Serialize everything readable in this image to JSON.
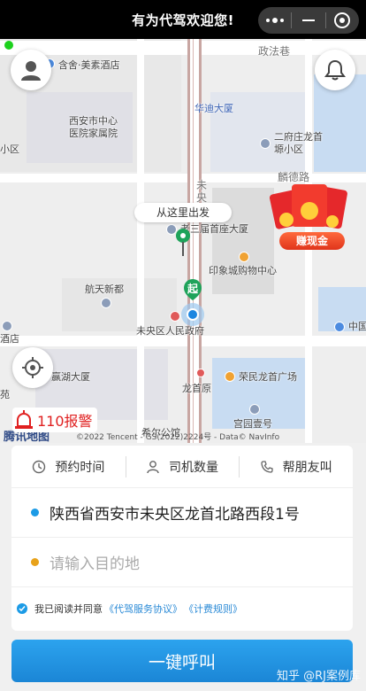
{
  "app": {
    "title": "有为代驾欢迎您!"
  },
  "capsule": {
    "more_icon": "more-dots-icon",
    "minimize_icon": "minus-icon",
    "close_icon": "target-circle-icon"
  },
  "map": {
    "labels": {
      "hotel1": "含舍·美素酒店",
      "lane": "政法巷",
      "huadi": "华迪大厦",
      "hospital_a": "西安市中心",
      "hospital_b": "医院家属院",
      "xiaoqu": "小区",
      "erfu_a": "二府庄龙首",
      "erfu_b": "塬小区",
      "qilin": "麟德路",
      "weiyang": "未央",
      "sanfu": "老三届首座大厦",
      "yinxiang": "印象城购物中心",
      "hangtian": "航天新都",
      "gov": "未央区人民政府",
      "zhongguo": "中国",
      "hotel2": "酒店",
      "yinghu": "赢湖大厦",
      "rongmin": "荣民龙首广场",
      "longshouyuan": "龙首原",
      "gongguan": "宫园壹号",
      "yuan": "苑",
      "qiyuan": "希尔公馆",
      "trip_mark": "起"
    },
    "tooltip": "从这里出发",
    "promo_label": "赚现金",
    "alarm_label": "110报警",
    "map_logo": "腾讯地图",
    "copyright": "©2022 Tencent - GS(2022)2224号 - Data© NavInfo"
  },
  "options": [
    {
      "label": "预约时间",
      "icon": "clock-icon"
    },
    {
      "label": "司机数量",
      "icon": "person-icon"
    },
    {
      "label": "帮朋友叫",
      "icon": "phone-icon"
    }
  ],
  "route": {
    "from": "陕西省西安市未央区龙首北路西段1号",
    "to_placeholder": "请输入目的地",
    "from_color": "#1c9be6",
    "to_color": "#e8a21a"
  },
  "agreement": {
    "prefix": "我已阅读并同意",
    "link1": "《代驾服务协议》",
    "link2": "《计费规则》"
  },
  "call_button": "一键呼叫",
  "watermark": "知乎 @RJ案例库"
}
